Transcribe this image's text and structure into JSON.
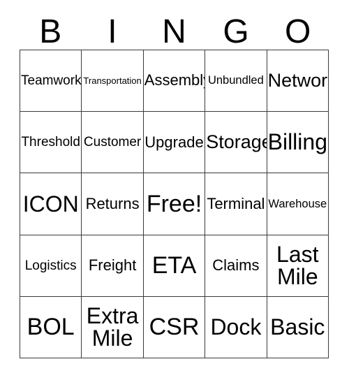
{
  "card": {
    "type": "bingo-card",
    "size": "5x5",
    "header": {
      "letters": [
        "B",
        "I",
        "N",
        "G",
        "O"
      ]
    },
    "grid": {
      "columns": 5,
      "rows": 5,
      "line_color": "#3a3a3a",
      "background_color": "#ffffff",
      "text_color": "#000000",
      "free_space": {
        "row": 3,
        "column": 3,
        "label": "Free!"
      },
      "cells": [
        [
          {
            "label": "Teamwork",
            "size": "md"
          },
          {
            "label": "Transportation",
            "size": "xs"
          },
          {
            "label": "Assembly",
            "size": "lg"
          },
          {
            "label": "Unbundled",
            "size": "sm"
          },
          {
            "label": "Network",
            "size": "xl"
          }
        ],
        [
          {
            "label": "Threshold",
            "size": "md"
          },
          {
            "label": "Customer",
            "size": "md"
          },
          {
            "label": "Upgrade",
            "size": "lg"
          },
          {
            "label": "Storage",
            "size": "xl"
          },
          {
            "label": "Billing",
            "size": "xxl"
          }
        ],
        [
          {
            "label": "ICON",
            "size": "xxl"
          },
          {
            "label": "Returns",
            "size": "lg"
          },
          {
            "label": "Free!",
            "size": "huge"
          },
          {
            "label": "Terminal",
            "size": "lg"
          },
          {
            "label": "Warehouse",
            "size": "sm"
          }
        ],
        [
          {
            "label": "Logistics",
            "size": "md"
          },
          {
            "label": "Freight",
            "size": "lg"
          },
          {
            "label": "ETA",
            "size": "huge"
          },
          {
            "label": "Claims",
            "size": "lg"
          },
          {
            "label": "Last\nMile",
            "size": "xxl"
          }
        ],
        [
          {
            "label": "BOL",
            "size": "huge"
          },
          {
            "label": "Extra\nMile",
            "size": "xxl"
          },
          {
            "label": "CSR",
            "size": "huge"
          },
          {
            "label": "Dock",
            "size": "xxl"
          },
          {
            "label": "Basic",
            "size": "xxl"
          }
        ]
      ]
    }
  }
}
